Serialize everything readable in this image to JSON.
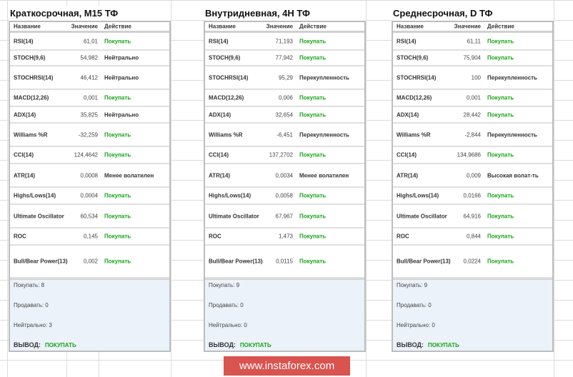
{
  "headers": {
    "name": "Название",
    "value": "Значение",
    "action": "Действие"
  },
  "panels": [
    {
      "title": "Краткосрочная, M15 ТФ",
      "rows": [
        {
          "name": "RSI(14)",
          "value": "61,01",
          "action": "Покупать"
        },
        {
          "name": "STOCH(9,6)",
          "value": "54,982",
          "action": "Нейтрально"
        },
        {
          "name": "STOCHRSI(14)",
          "value": "46,412",
          "action": "Нейтрально"
        },
        {
          "name": "MACD(12,26)",
          "value": "0,001",
          "action": "Покупать"
        },
        {
          "name": "ADX(14)",
          "value": "35,825",
          "action": "Нейтрально"
        },
        {
          "name": "Williams %R",
          "value": "-32,259",
          "action": "Покупать"
        },
        {
          "name": "CCI(14)",
          "value": "124,4642",
          "action": "Покупать"
        },
        {
          "name": "ATR(14)",
          "value": "0,0008",
          "action": "Менее волатилен"
        },
        {
          "name": "Highs/Lows(14)",
          "value": "0,0004",
          "action": "Покупать"
        },
        {
          "name": "Ultimate Oscillator",
          "value": "60,534",
          "action": "Покупать"
        },
        {
          "name": "ROC",
          "value": "0,145",
          "action": "Покупать"
        },
        {
          "name": "Bull/Bear Power(13)",
          "value": "0,002",
          "action": "Покупать"
        }
      ],
      "summary": {
        "buy": "Покупать: 8",
        "sell": "Продавать: 0",
        "neutral": "Нейтрально: 3",
        "conclusion_label": "ВЫВОД:",
        "conclusion": "ПОКУПАТЬ"
      }
    },
    {
      "title": "Внутридневная, 4H ТФ",
      "rows": [
        {
          "name": "RSI(14)",
          "value": "71,193",
          "action": "Покупать"
        },
        {
          "name": "STOCH(9,6)",
          "value": "77,942",
          "action": "Покупать"
        },
        {
          "name": "STOCHRSI(14)",
          "value": "95,29",
          "action": "Перекупленность"
        },
        {
          "name": "MACD(12,26)",
          "value": "0,006",
          "action": "Покупать"
        },
        {
          "name": "ADX(14)",
          "value": "32,654",
          "action": "Покупать"
        },
        {
          "name": "Williams %R",
          "value": "-6,451",
          "action": "Перекупленность"
        },
        {
          "name": "CCI(14)",
          "value": "137,2702",
          "action": "Покупать"
        },
        {
          "name": "ATR(14)",
          "value": "0,0034",
          "action": "Менее волатилен"
        },
        {
          "name": "Highs/Lows(14)",
          "value": "0,0058",
          "action": "Покупать"
        },
        {
          "name": "Ultimate Oscillator",
          "value": "67,967",
          "action": "Покупать"
        },
        {
          "name": "ROC",
          "value": "1,473",
          "action": "Покупать"
        },
        {
          "name": "Bull/Bear Power(13)",
          "value": "0,0115",
          "action": "Покупать"
        }
      ],
      "summary": {
        "buy": "Покупать: 9",
        "sell": "Продавать: 0",
        "neutral": "Нейтрально: 0",
        "conclusion_label": "ВЫВОД:",
        "conclusion": "ПОКУПАТЬ"
      }
    },
    {
      "title": "Среднесрочная, D ТФ",
      "rows": [
        {
          "name": "RSI(14)",
          "value": "61,11",
          "action": "Покупать"
        },
        {
          "name": "STOCH(9,6)",
          "value": "75,904",
          "action": "Покупать"
        },
        {
          "name": "STOCHRSI(14)",
          "value": "100",
          "action": "Перекупленность"
        },
        {
          "name": "MACD(12,26)",
          "value": "0,001",
          "action": "Покупать"
        },
        {
          "name": "ADX(14)",
          "value": "28,442",
          "action": "Покупать"
        },
        {
          "name": "Williams %R",
          "value": "-2,844",
          "action": "Перекупленность"
        },
        {
          "name": "CCI(14)",
          "value": "134,9686",
          "action": "Покупать"
        },
        {
          "name": "ATR(14)",
          "value": "0,009",
          "action": "Высокая волат-ть"
        },
        {
          "name": "Highs/Lows(14)",
          "value": "0,0166",
          "action": "Покупать"
        },
        {
          "name": "Ultimate Oscillator",
          "value": "64,916",
          "action": "Покупать"
        },
        {
          "name": "ROC",
          "value": "0,844",
          "action": "Покупать"
        },
        {
          "name": "Bull/Bear Power(13)",
          "value": "0,0224",
          "action": "Покупать"
        }
      ],
      "summary": {
        "buy": "Покупать: 9",
        "sell": "Продавать: 0",
        "neutral": "Нейтрально: 0",
        "conclusion_label": "ВЫВОД:",
        "conclusion": "ПОКУПАТЬ"
      }
    }
  ],
  "colors": {
    "buy": "#1aa31a",
    "summary_bg": "#ebf2f9",
    "banner": "#d9534f"
  },
  "banner": "www.instaforex.com"
}
